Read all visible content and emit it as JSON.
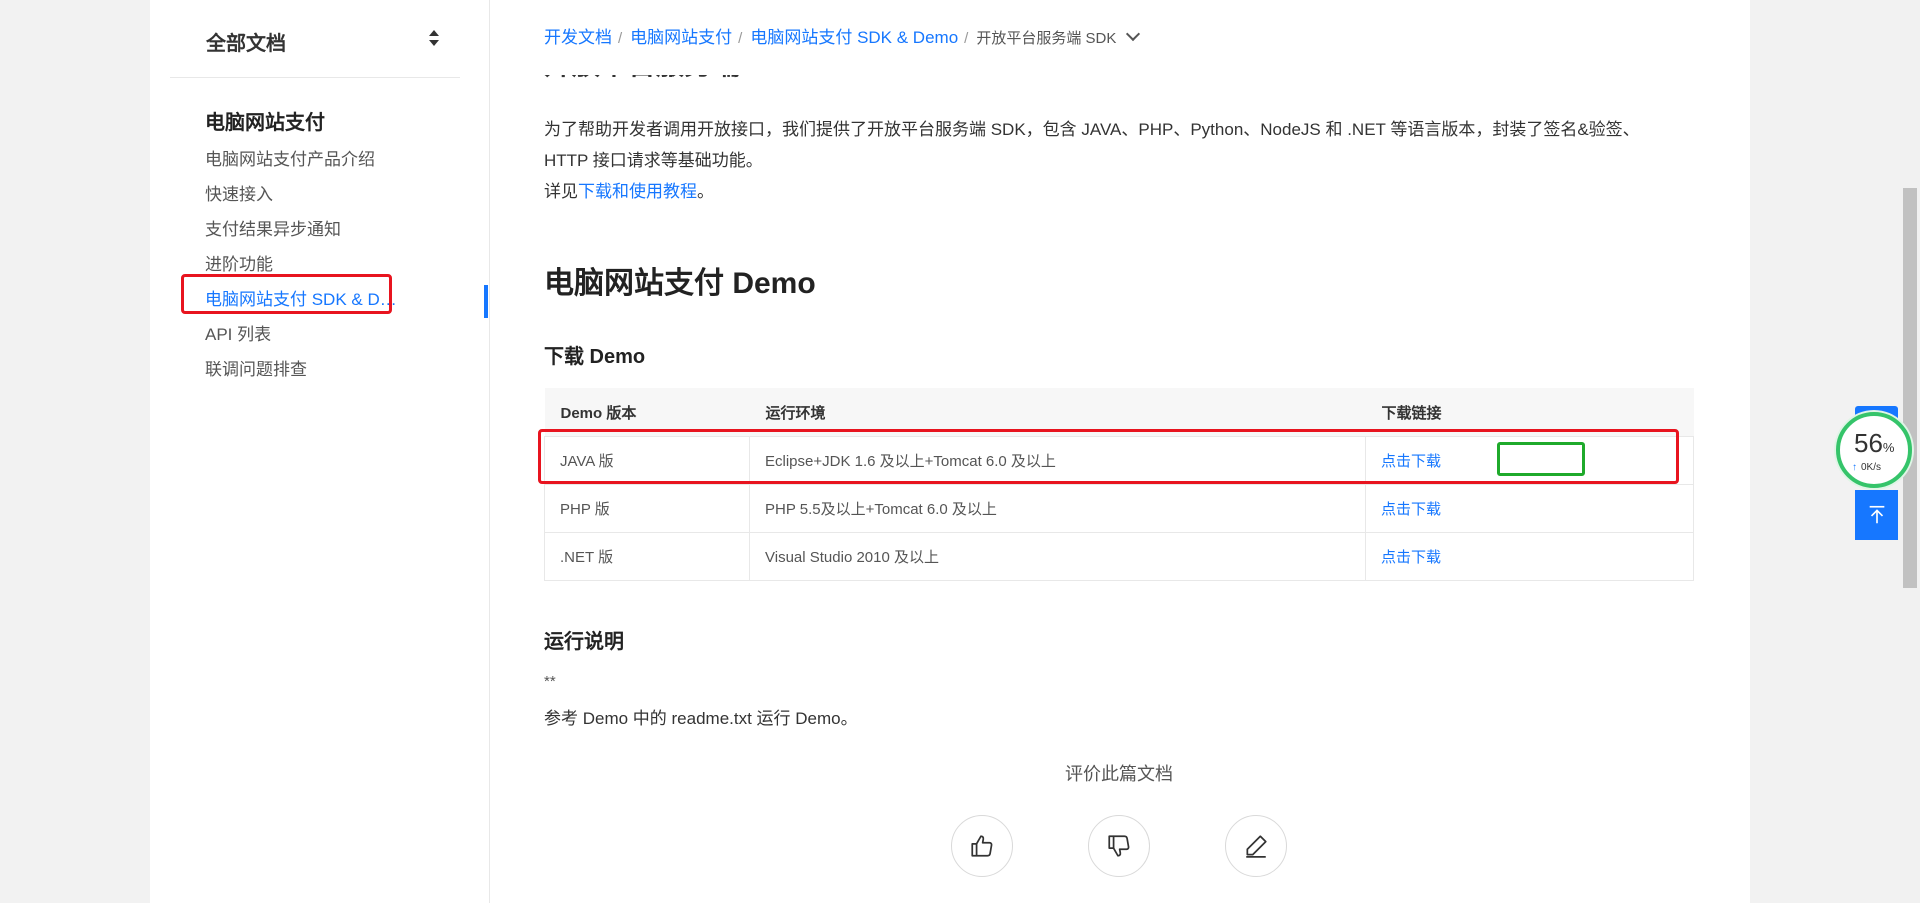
{
  "sidebar": {
    "title": "全部文档",
    "section": "电脑网站支付",
    "items": [
      {
        "label": "电脑网站支付产品介绍"
      },
      {
        "label": "快速接入"
      },
      {
        "label": "支付结果异步通知"
      },
      {
        "label": "进阶功能"
      },
      {
        "label": "电脑网站支付 SDK & D…",
        "active": true
      },
      {
        "label": "API 列表"
      },
      {
        "label": "联调问题排查"
      }
    ]
  },
  "breadcrumb": {
    "items": [
      "开发文档",
      "电脑网站支付",
      "电脑网站支付 SDK & Demo"
    ],
    "current": "开放平台服务端 SDK"
  },
  "content": {
    "peek_heading": "开放平台服务端 SDK",
    "intro_line1": "为了帮助开发者调用开放接口，我们提供了开放平台服务端 SDK，包含 JAVA、PHP、Python、NodeJS 和 .NET 等语言版本，封装了签名&验签、",
    "intro_line2": "HTTP 接口请求等基础功能。",
    "see_prefix": "详见",
    "see_link": "下载和使用教程",
    "see_suffix": "。",
    "h2": "电脑网站支付 Demo",
    "h3_download": "下载 Demo",
    "table": {
      "headers": [
        "Demo 版本",
        "运行环境",
        "下载链接"
      ],
      "rows": [
        {
          "version": "JAVA 版",
          "env": "Eclipse+JDK 1.6 及以上+Tomcat 6.0 及以上",
          "link": "点击下载"
        },
        {
          "version": "PHP 版",
          "env": "PHP 5.5及以上+Tomcat 6.0 及以上",
          "link": "点击下载"
        },
        {
          "version": ".NET 版",
          "env": "Visual Studio 2010 及以上",
          "link": "点击下载"
        }
      ]
    },
    "h3_run": "运行说明",
    "stars": "**",
    "run_note": "参考 Demo 中的 readme.txt 运行 Demo。",
    "rate_title": "评价此篇文档"
  },
  "widget": {
    "percent": "56",
    "percent_unit": "%",
    "rate": "0K/s",
    "accent": "#1677ff",
    "ring_color": "#35c46a"
  },
  "colors": {
    "link": "#1677ff",
    "highlight_red": "#e8141f",
    "highlight_green": "#1faa2b"
  }
}
